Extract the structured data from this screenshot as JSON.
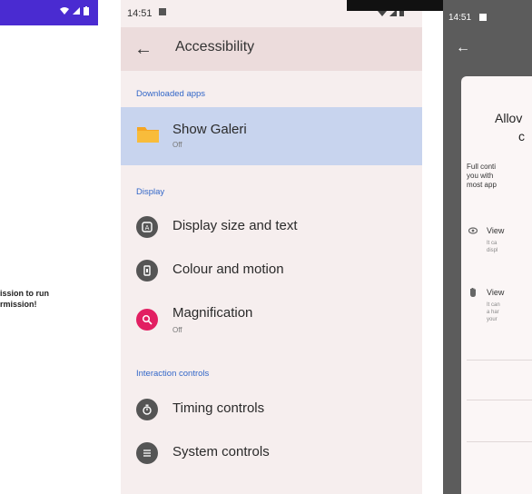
{
  "left": {
    "message_line1": "ission to run",
    "message_line2": "rmission!"
  },
  "center": {
    "status": {
      "time": "14:51"
    },
    "title": "Accessibility",
    "sections": {
      "downloaded_apps": "Downloaded apps",
      "display": "Display",
      "interaction_controls": "Interaction controls"
    },
    "items": {
      "show_galeri": {
        "label": "Show Galeri",
        "sub": "Off",
        "icon": "folder-icon"
      },
      "display_size": {
        "label": "Display size and text",
        "icon": "text-size-icon"
      },
      "colour_motion": {
        "label": "Colour and motion",
        "icon": "color-motion-icon"
      },
      "magnification": {
        "label": "Magnification",
        "sub": "Off",
        "icon": "magnify-icon",
        "color": "#e21f62"
      },
      "timing": {
        "label": "Timing controls",
        "icon": "timer-icon"
      },
      "system": {
        "label": "System controls",
        "icon": "system-controls-icon"
      }
    },
    "colors": {
      "section": "#3367c8",
      "selected": "#c8d4ee",
      "appbar": "#ecdcdc"
    }
  },
  "right": {
    "status": {
      "time": "14:51"
    },
    "dialog": {
      "title_line1": "Allov",
      "title_line2": "c",
      "body_line1": "Full conti",
      "body_line2": "you with",
      "body_line3": "most app",
      "perm1_title": "View",
      "perm1_desc1": "It ca",
      "perm1_desc2": "displ",
      "perm2_title": "View",
      "perm2_desc1": "It can",
      "perm2_desc2": "a har",
      "perm2_desc3": "your"
    }
  }
}
